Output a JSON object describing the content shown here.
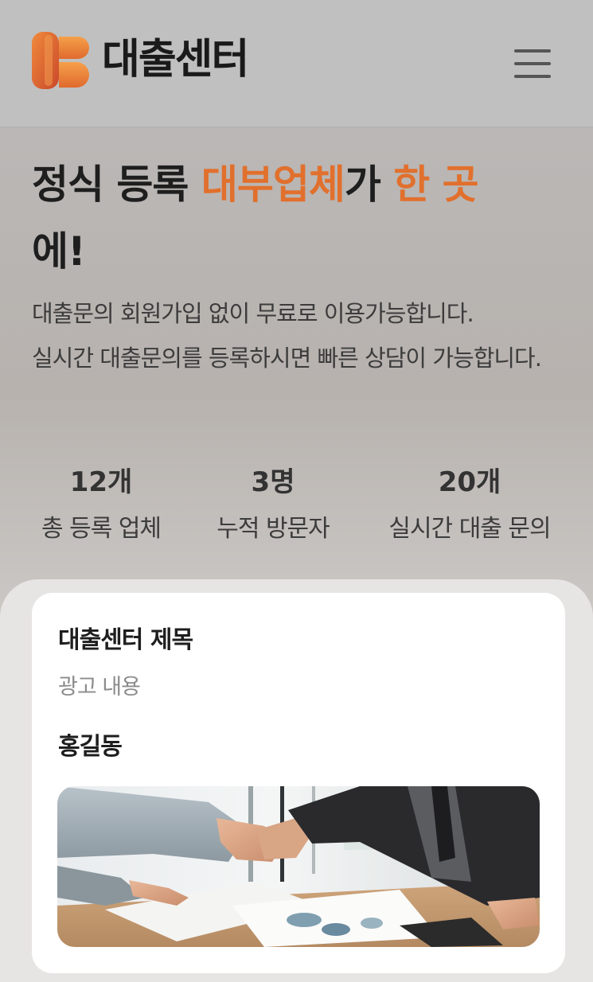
{
  "header": {
    "logo_text": "대출센터",
    "logo_icon": "logo-mark-icon",
    "menu_icon": "hamburger-icon"
  },
  "hero": {
    "title_part1": "정식 등록 ",
    "title_accent1": "대부업체",
    "title_part2": "가 ",
    "title_accent2": "한 곳",
    "title_part3": "에!",
    "description_line1": "대출문의 회원가입 없이 무료로 이용가능합니다.",
    "description_line2": "실시간 대출문의를 등록하시면 빠른 상담이 가능합니다."
  },
  "stats": [
    {
      "value": "12개",
      "label": "총 등록 업체"
    },
    {
      "value": "3명",
      "label": "누적 방문자"
    },
    {
      "value": "20개",
      "label": "실시간 대출 문의"
    }
  ],
  "card": {
    "title": "대출센터 제목",
    "subtitle": "광고 내용",
    "author": "홍길동",
    "image": "handshake-photo"
  },
  "colors": {
    "accent": "#e1702d",
    "header_bg": "#c0c0c0",
    "card_bg": "#ffffff"
  }
}
